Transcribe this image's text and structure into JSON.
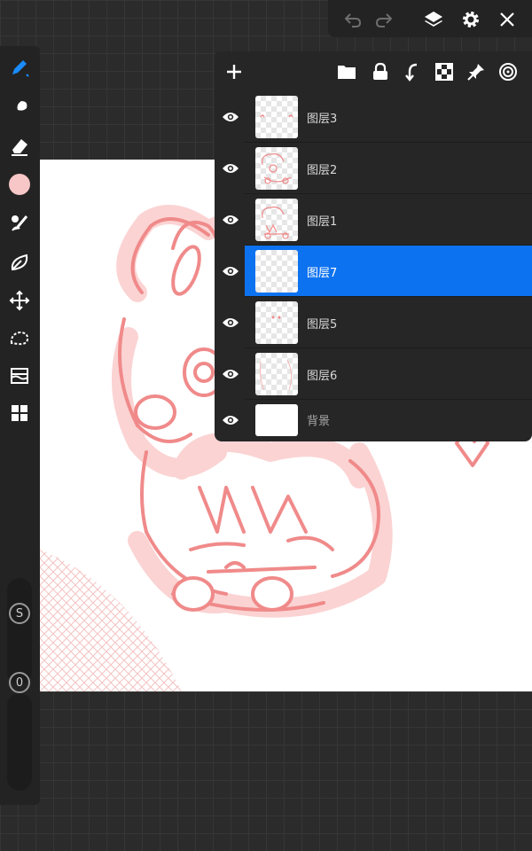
{
  "top_toolbar": {
    "icons": [
      "undo-icon",
      "redo-icon",
      "layers-icon",
      "settings-icon",
      "close-icon"
    ]
  },
  "left_toolbar": {
    "tools": [
      "brush-icon",
      "smudge-icon",
      "eraser-icon",
      "color-swatch",
      "brush-library-icon",
      "shape-icon",
      "transform-icon",
      "selection-icon",
      "adjustments-icon",
      "gallery-icon"
    ],
    "current_color": "#f7c6c6",
    "size_label": "S",
    "opacity_label": "0"
  },
  "layers_panel": {
    "header_icons": [
      "add-icon",
      "folder-icon",
      "lock-icon",
      "merge-down-icon",
      "alpha-lock-icon",
      "pin-icon",
      "reference-icon"
    ],
    "layers": [
      {
        "name": "图层3",
        "selected": false
      },
      {
        "name": "图层2",
        "selected": false
      },
      {
        "name": "图层1",
        "selected": false
      },
      {
        "name": "图层7",
        "selected": true
      },
      {
        "name": "图层5",
        "selected": false
      },
      {
        "name": "图层6",
        "selected": false
      }
    ],
    "background_layer": "背景"
  },
  "colors": {
    "accent": "#0d72f0",
    "sketch": "#f08a8a",
    "sketch_halo": "#fbd3d3"
  }
}
